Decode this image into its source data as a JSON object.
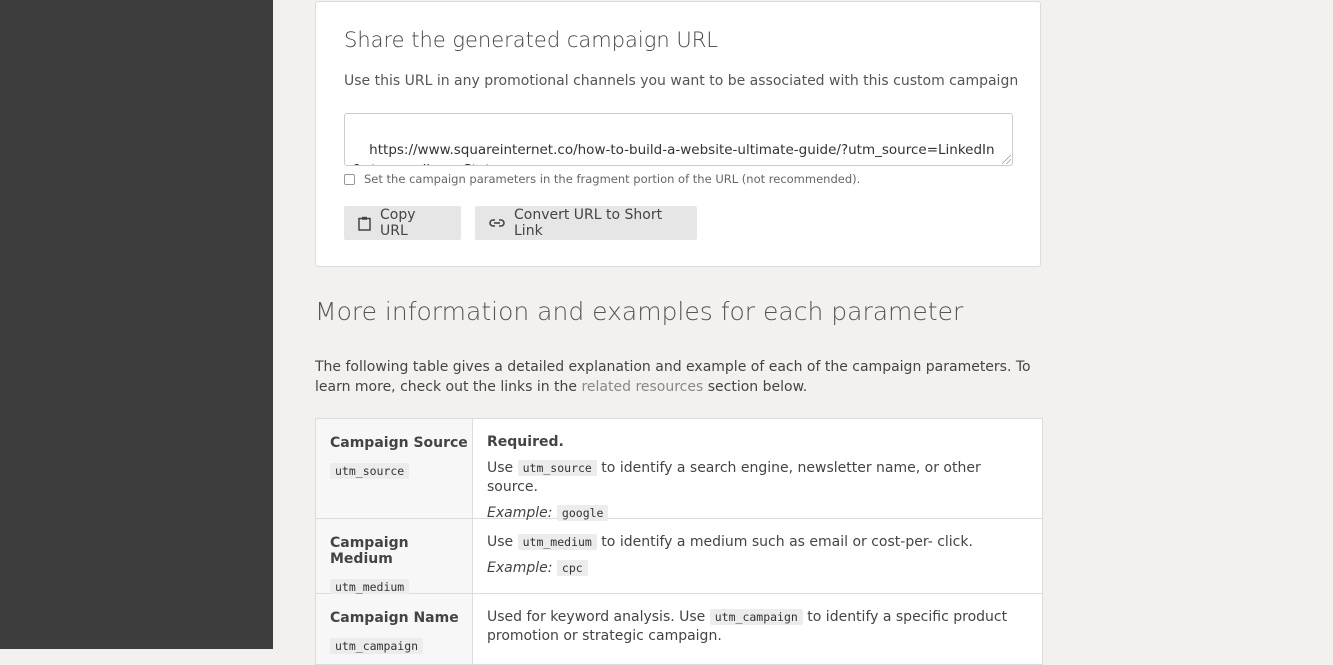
{
  "share": {
    "title": "Share the generated campaign URL",
    "description": "Use this URL in any promotional channels you want to be associated with this custom campaign",
    "url": "https://www.squareinternet.co/how-to-build-a-website-ultimate-guide/?utm_source=LinkedIn&utm_medium=Status",
    "fragment_label": "Set the campaign parameters in the fragment portion of the URL (not recommended).",
    "copy_label": "Copy URL",
    "short_label": "Convert URL to Short Link"
  },
  "info": {
    "heading": "More information and examples for each parameter",
    "intro_before": "The following table gives a detailed explanation and example of each of the campaign parameters. To learn more, check out the links in the ",
    "intro_link": "related resources",
    "intro_after": " section below."
  },
  "params": [
    {
      "name": "Campaign Source",
      "code": "utm_source",
      "required": "Required.",
      "desc_pre": "Use ",
      "desc_code": "utm_source",
      "desc_post": " to identify a search engine, newsletter name, or other source.",
      "example_label": "Example:",
      "example": "google"
    },
    {
      "name": "Campaign Medium",
      "code": "utm_medium",
      "desc_pre": "Use ",
      "desc_code": "utm_medium",
      "desc_post": " to identify a medium such as email or cost-per- click.",
      "example_label": "Example:",
      "example": "cpc"
    },
    {
      "name": "Campaign Name",
      "code": "utm_campaign",
      "desc_pre": "Used for keyword analysis. Use ",
      "desc_code": "utm_campaign",
      "desc_post": " to identify a specific product promotion or strategic campaign."
    }
  ],
  "colors": {
    "sidebar": "#3d3d3d",
    "background": "#f2f1ef",
    "button": "#e6e6e6"
  }
}
